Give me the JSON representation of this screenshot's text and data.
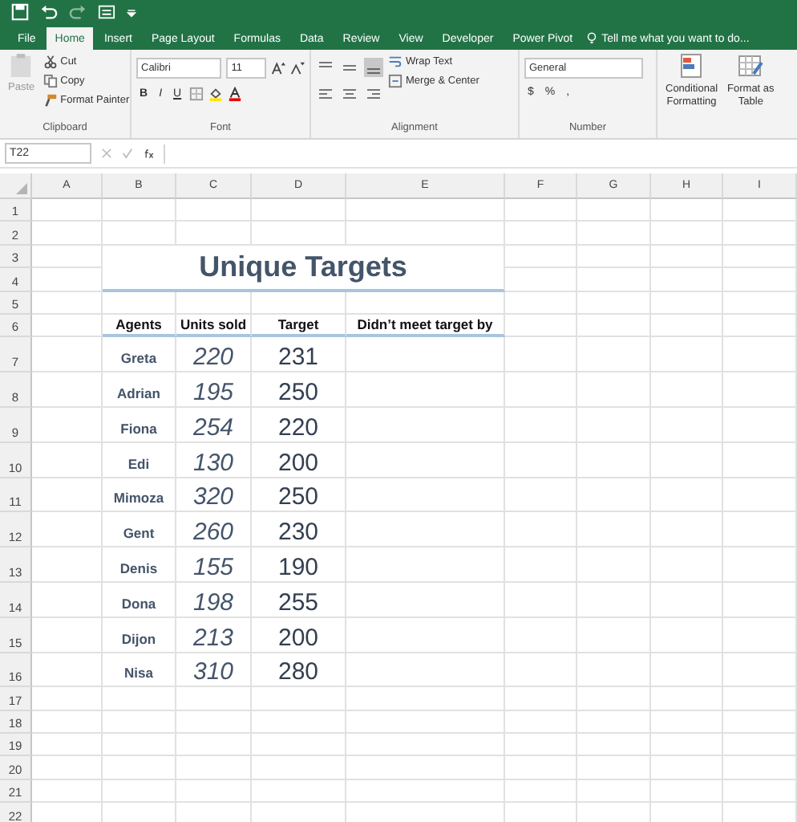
{
  "tabs": [
    {
      "label": "File",
      "selected": false
    },
    {
      "label": "Home",
      "selected": true
    },
    {
      "label": "Insert",
      "selected": false
    },
    {
      "label": "Page Layout",
      "selected": false
    },
    {
      "label": "Formulas",
      "selected": false
    },
    {
      "label": "Data",
      "selected": false
    },
    {
      "label": "Review",
      "selected": false
    },
    {
      "label": "View",
      "selected": false
    },
    {
      "label": "Developer",
      "selected": false
    },
    {
      "label": "Power Pivot",
      "selected": false
    }
  ],
  "tell_me": "Tell me what you want to do...",
  "ribbon": {
    "clipboard": {
      "label": "Clipboard",
      "paste": "Paste",
      "cut": "Cut",
      "copy": "Copy",
      "format_painter": "Format Painter"
    },
    "font": {
      "label": "Font",
      "font_name": "Calibri",
      "font_size": "11",
      "bold": "B",
      "italic": "I",
      "underline": "U"
    },
    "alignment": {
      "label": "Alignment",
      "wrap_text": "Wrap Text",
      "merge": "Merge & Center"
    },
    "number": {
      "label": "Number",
      "format": "General",
      "currency": "$",
      "percent": "%",
      "comma": ","
    },
    "styles": {
      "conditional": [
        "Conditional",
        "Formatting"
      ],
      "format_table": [
        "Format as",
        "Table"
      ]
    }
  },
  "name_box": "T22",
  "column_headers": [
    "A",
    "B",
    "C",
    "D",
    "E",
    "F",
    "G",
    "H",
    "I"
  ],
  "row_headers": [
    "1",
    "2",
    "3",
    "4",
    "5",
    "6",
    "7",
    "8",
    "9",
    "10",
    "11",
    "12",
    "13",
    "14",
    "15",
    "16",
    "17",
    "18",
    "19",
    "20",
    "21",
    "22"
  ],
  "title": "Unique Targets",
  "table": {
    "columns": [
      "Agents",
      "Units sold",
      "Target",
      "Didn’t meet target by"
    ],
    "rows": [
      {
        "agent": "Greta",
        "units_sold": "220",
        "target": "231"
      },
      {
        "agent": "Adrian",
        "units_sold": "195",
        "target": "250"
      },
      {
        "agent": "Fiona",
        "units_sold": "254",
        "target": "220"
      },
      {
        "agent": "Edi",
        "units_sold": "130",
        "target": "200"
      },
      {
        "agent": "Mimoza",
        "units_sold": "320",
        "target": "250"
      },
      {
        "agent": "Gent",
        "units_sold": "260",
        "target": "230"
      },
      {
        "agent": "Denis",
        "units_sold": "155",
        "target": "190"
      },
      {
        "agent": "Dona",
        "units_sold": "198",
        "target": "255"
      },
      {
        "agent": "Dijon",
        "units_sold": "213",
        "target": "200"
      },
      {
        "agent": "Nisa",
        "units_sold": "310",
        "target": "280"
      }
    ]
  }
}
